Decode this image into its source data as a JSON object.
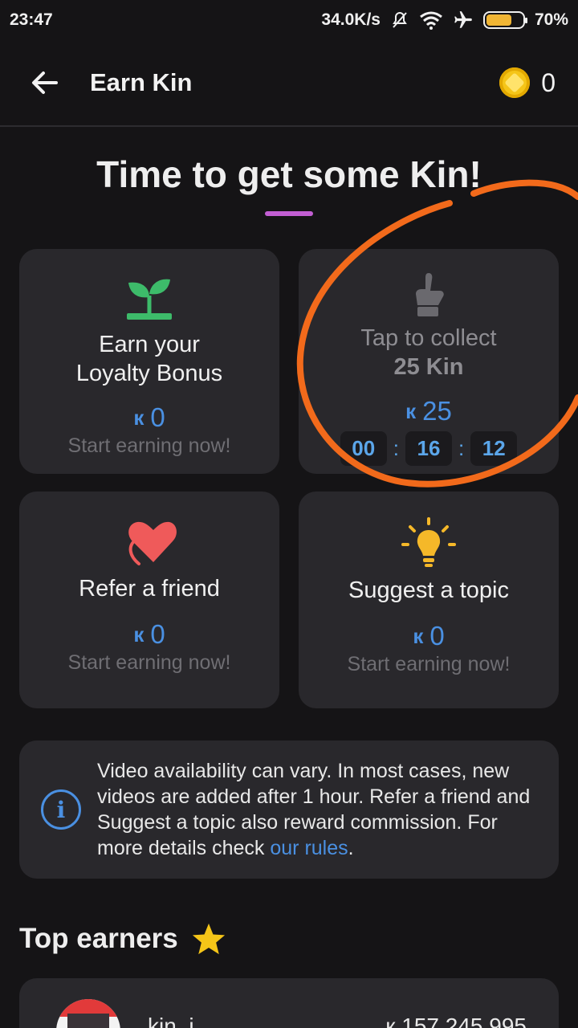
{
  "status_bar": {
    "time": "23:47",
    "network_speed": "34.0K/s",
    "battery": "70%",
    "battery_level": 0.7,
    "icons": [
      "mute-icon",
      "wifi-icon",
      "airplane-icon",
      "battery-icon"
    ]
  },
  "app_bar": {
    "title": "Earn Kin",
    "balance": "0",
    "back_icon": "arrow-left-icon",
    "coin_icon": "kin-coin-icon"
  },
  "headline": "Time to get some Kin!",
  "accent_color": "#c25fd3",
  "link_color": "#4a90e2",
  "cards": {
    "loyalty": {
      "title_line1": "Earn your",
      "title_line2": "Loyalty Bonus",
      "kin_symbol": "к",
      "amount": "0",
      "subtitle": "Start earning now!",
      "icon": "sprout-icon"
    },
    "collect": {
      "title_line1": "Tap to collect",
      "title_line2": "25 Kin",
      "kin_symbol": "к",
      "amount": "25",
      "timer_hours": "00",
      "timer_minutes": "16",
      "timer_seconds": "12",
      "icon": "pointing-hand-icon"
    },
    "refer": {
      "title": "Refer a friend",
      "kin_symbol": "к",
      "amount": "0",
      "subtitle": "Start earning now!",
      "icon": "heart-icon"
    },
    "suggest": {
      "title": "Suggest a topic",
      "kin_symbol": "к",
      "amount": "0",
      "subtitle": "Start earning now!",
      "icon": "lightbulb-icon"
    }
  },
  "info": {
    "text": "Video availability can vary. In most cases, new videos are added after 1 hour. Refer a friend and Suggest a topic also reward commission. For more details check ",
    "link": "our rules",
    "suffix": ".",
    "icon": "info-icon"
  },
  "top_earners": {
    "title": "Top earners",
    "icon": "star-icon",
    "first_row": {
      "name": "kin_i...",
      "amount": "к 157,245,995"
    }
  }
}
